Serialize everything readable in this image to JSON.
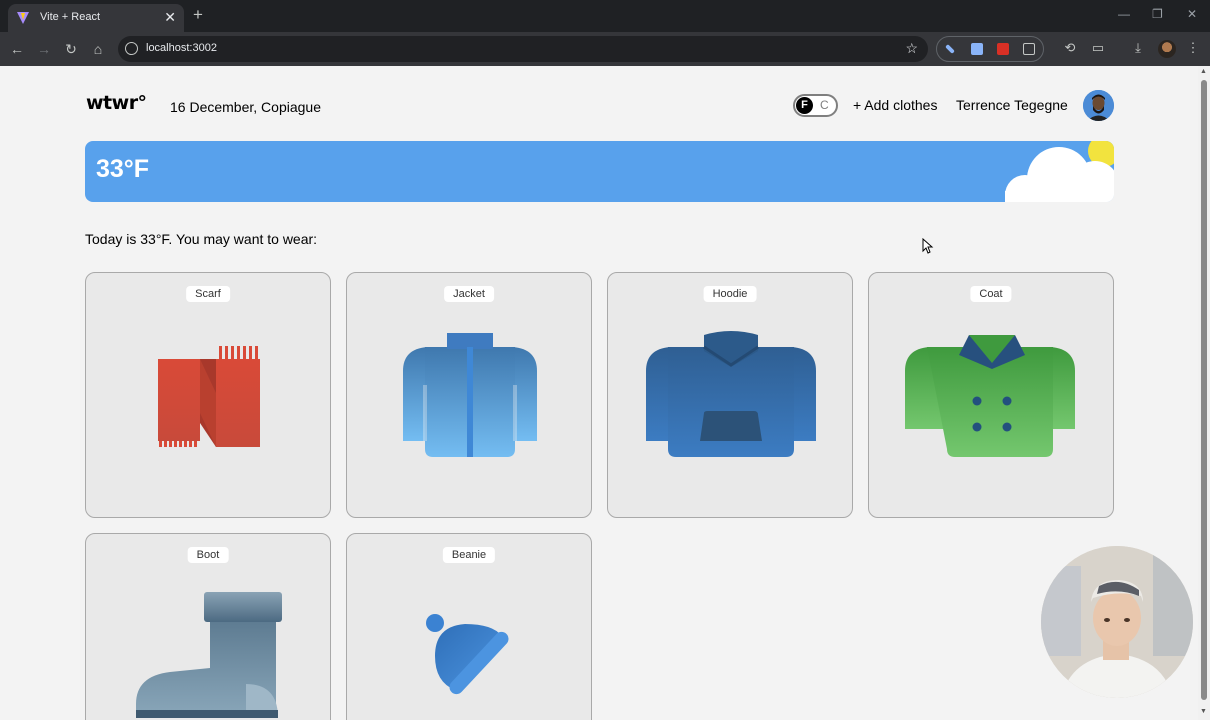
{
  "browser": {
    "tab_title": "Vite + React",
    "tab_close": "✕",
    "new_tab": "+",
    "url": "localhost:3002",
    "window_controls": {
      "minimize": "—",
      "restore": "❐",
      "close": "✕"
    }
  },
  "header": {
    "logo": "wtwr°",
    "date_location": "16 December, Copiague",
    "unit_toggle": {
      "selected": "F",
      "other": "C"
    },
    "add_clothes": "+ Add clothes",
    "username": "Terrence Tegegne"
  },
  "weather": {
    "temperature": "33°F",
    "condition_icon": "cloud-sun-icon"
  },
  "main": {
    "recommendation": "Today is 33°F. You may want to wear:",
    "items": [
      {
        "label": "Scarf"
      },
      {
        "label": "Jacket"
      },
      {
        "label": "Hoodie"
      },
      {
        "label": "Coat"
      },
      {
        "label": "Boot"
      },
      {
        "label": "Beanie"
      }
    ]
  },
  "colors": {
    "weather_banner": "#58a1ec",
    "scarf": "#d44a3a",
    "jacket": "#6cb2ea",
    "hoodie": "#3a77b5",
    "coat": "#5fb85a",
    "boot": "#6e8a9c",
    "beanie": "#3f86d6"
  }
}
